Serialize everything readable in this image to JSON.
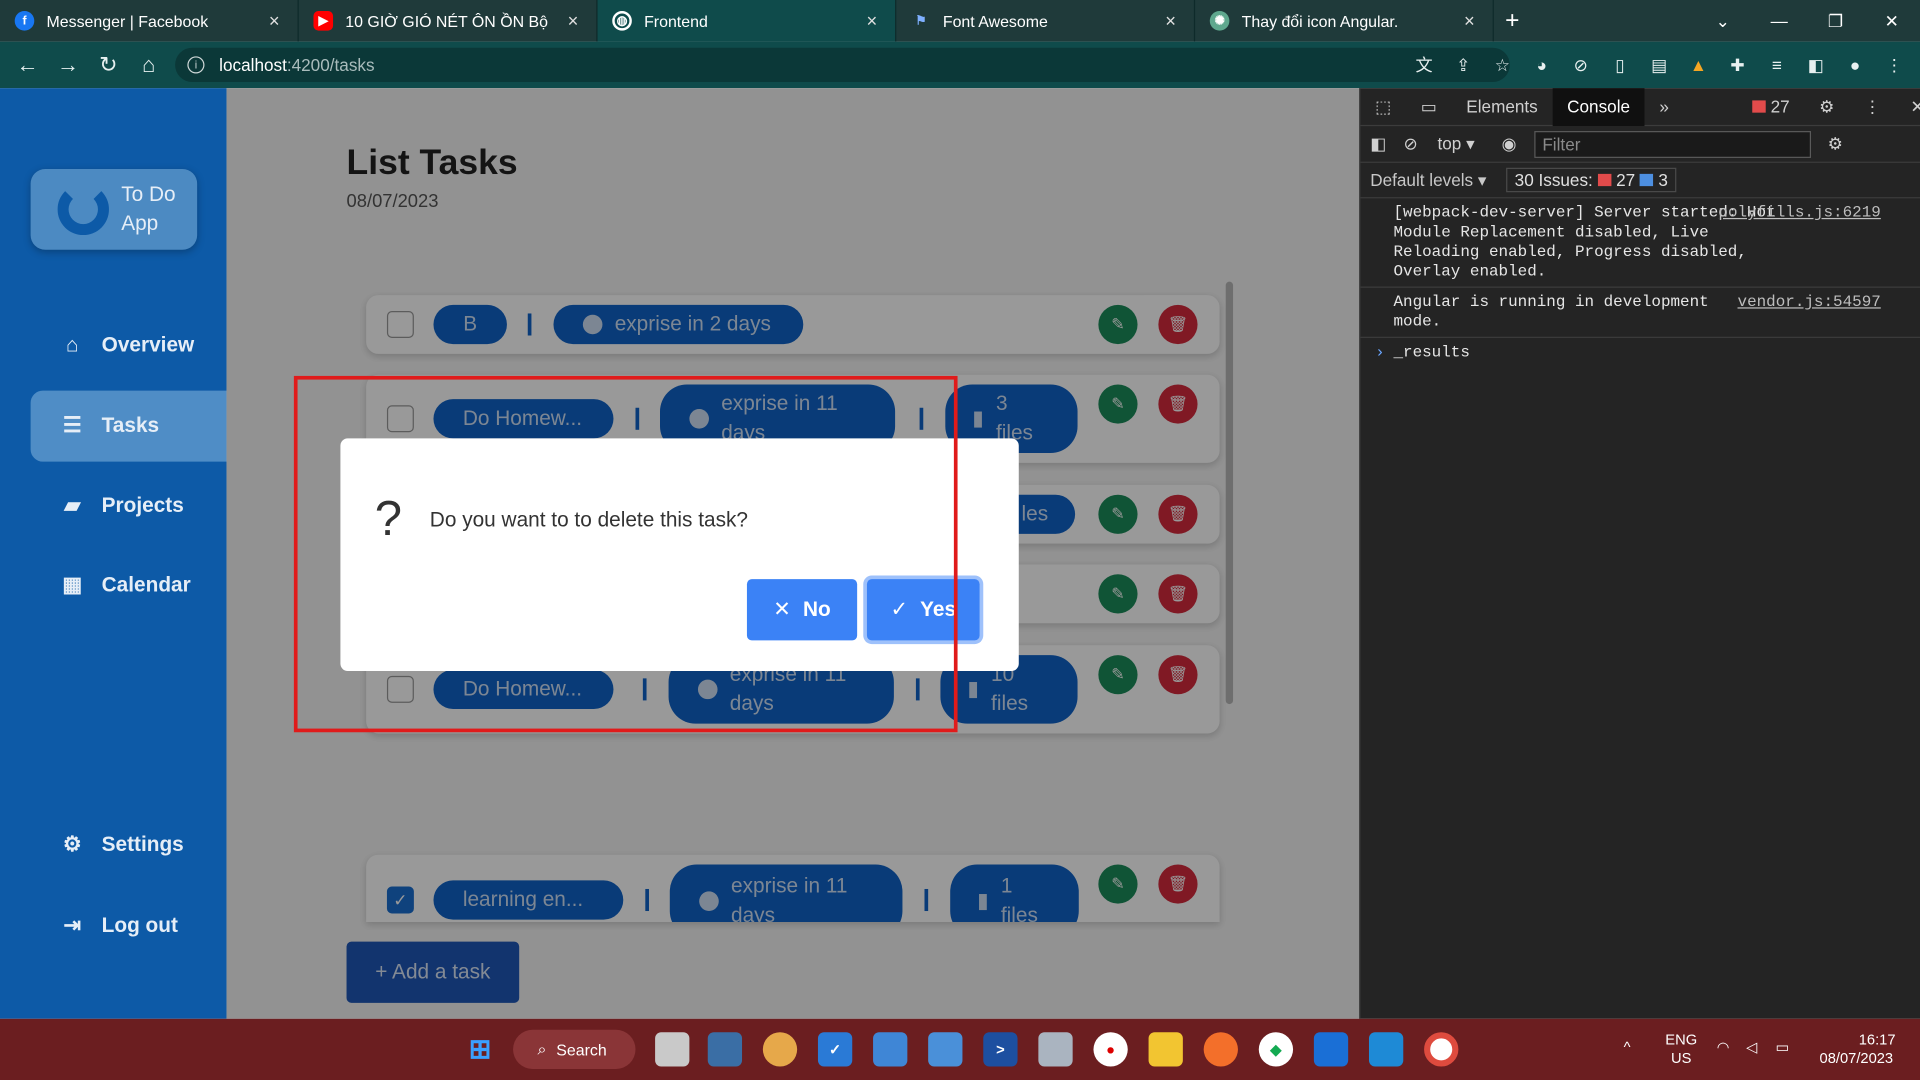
{
  "browser": {
    "tabs": [
      {
        "title": "Messenger | Facebook",
        "icon": "facebook-icon",
        "color": "#1877f2"
      },
      {
        "title": "10 GIỜ GIÓ NÉT ÔN ỒN Bộ",
        "icon": "youtube-icon",
        "color": "#ff0000"
      },
      {
        "title": "Frontend",
        "icon": "globe-icon",
        "color": "#5aa0a0"
      },
      {
        "title": "Font Awesome",
        "icon": "flag-icon",
        "color": "#528dd7"
      },
      {
        "title": "Thay đổi icon Angular.",
        "icon": "chatgpt-icon",
        "color": "#5fa88e"
      }
    ],
    "url_host": "localhost",
    "url_path": ":4200/tasks"
  },
  "sidebar": {
    "logo_line1": "To Do",
    "logo_line2": "App",
    "items": [
      {
        "label": "Overview",
        "icon": "home-icon"
      },
      {
        "label": "Tasks",
        "icon": "list-icon"
      },
      {
        "label": "Projects",
        "icon": "folder-icon"
      },
      {
        "label": "Calendar",
        "icon": "calendar-icon"
      },
      {
        "label": "Settings",
        "icon": "gear-icon"
      },
      {
        "label": "Log out",
        "icon": "logout-icon"
      }
    ]
  },
  "main": {
    "title": "List Tasks",
    "date": "08/07/2023",
    "add_label": "+ Add a task",
    "tasks": [
      {
        "name": "B",
        "due": "exprise in 2 days",
        "checked": false
      },
      {
        "name": "Do Homew...",
        "due": "exprise in 11",
        "due2": "days",
        "files": "3",
        "files_label": "files",
        "checked": false
      },
      {
        "files_partial": "les",
        "checked": false
      },
      {
        "checked": false
      },
      {
        "name": "Do Homew...",
        "due": "exprise in 11",
        "due2": "days",
        "files": "10",
        "files_label": "files",
        "checked": false
      },
      {
        "name": "learning en...",
        "due": "exprise in 11",
        "due2": "days",
        "files": "1",
        "files_label": "files",
        "checked": true
      }
    ]
  },
  "dialog": {
    "icon": "?",
    "message": "Do you want to to delete this task?",
    "no_label": "No",
    "yes_label": "Yes"
  },
  "devtools": {
    "tab_elements": "Elements",
    "tab_console": "Console",
    "error_count": "27",
    "context": "top",
    "filter_placeholder": "Filter",
    "levels": "Default levels",
    "issues_label": "30 Issues:",
    "issues_errors": "27",
    "issues_info": "3",
    "logs": [
      {
        "text": "[webpack-dev-server] Server started: Hot Module Replacement disabled, Live Reloading enabled, Progress disabled, Overlay enabled.",
        "src": "polyfills.js:6219"
      },
      {
        "text": "Angular is running in development mode.",
        "src": "vendor.js:54597"
      }
    ],
    "prompt": "_results"
  },
  "taskbar": {
    "search_label": "Search",
    "lang1": "ENG",
    "lang2": "US",
    "time": "16:17",
    "date": "08/07/2023"
  }
}
